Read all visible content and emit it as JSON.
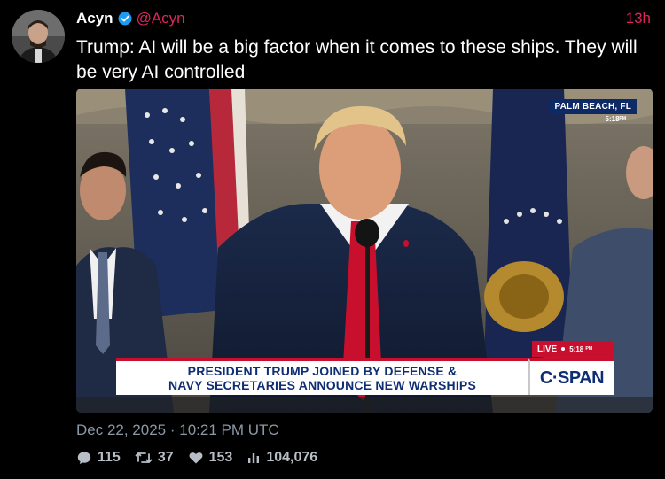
{
  "author": {
    "display_name": "Acyn",
    "handle": "@Acyn",
    "verified": true,
    "time_ago": "13h"
  },
  "post": {
    "text": "Trump: AI will be a big factor when it comes to these ships. They will be very AI controlled"
  },
  "media": {
    "location": "PALM BEACH, FL",
    "bug_time": "5:18ᴾᴹ",
    "live_label": "LIVE",
    "live_time": "5:18 ᴾᴹ",
    "chyron_line1": "PRESIDENT TRUMP JOINED BY DEFENSE &",
    "chyron_line2": "NAVY SECRETARIES ANNOUNCE NEW WARSHIPS",
    "network": "C·SPAN"
  },
  "timestamp": "Dec 22, 2025 · 10:21 PM UTC",
  "stats": {
    "replies": "115",
    "reposts": "37",
    "likes": "153",
    "views": "104,076"
  },
  "colors": {
    "background": "#000000",
    "accent": "#e0245e",
    "verified": "#1d9bf0",
    "muted": "#8b98a5",
    "chyron_text": "#0f2d73",
    "cspan_red": "#c8102e"
  },
  "icons": [
    "verified-badge-icon",
    "reply-icon",
    "repost-icon",
    "like-icon",
    "views-icon"
  ]
}
